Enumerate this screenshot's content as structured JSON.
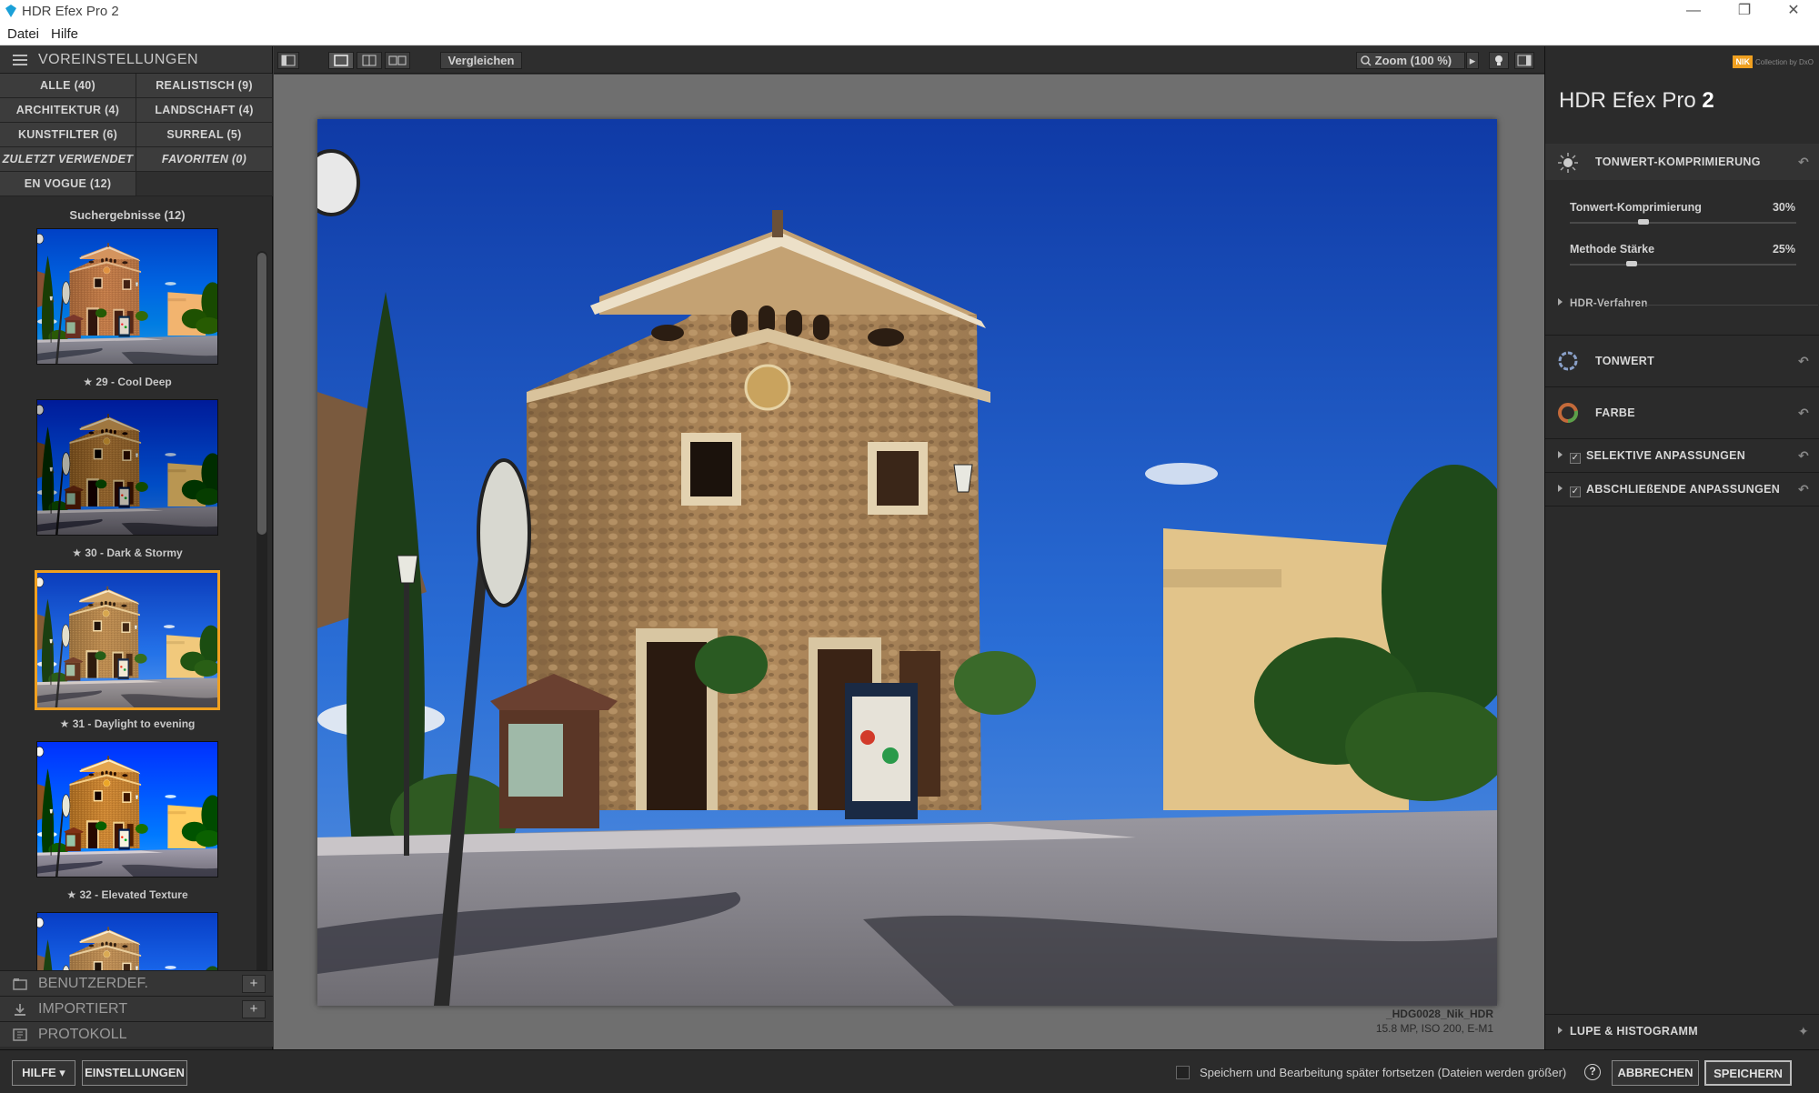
{
  "window": {
    "title": "HDR Efex Pro 2",
    "minimize": "—",
    "restore": "❐",
    "close": "✕"
  },
  "menu": {
    "items": [
      "Datei",
      "Hilfe"
    ]
  },
  "left_panel": {
    "header": "VOREINSTELLUNGEN",
    "presets": [
      "ALLE (40)",
      "REALISTISCH (9)",
      "ARCHITEKTUR (4)",
      "LANDSCHAFT (4)",
      "KUNSTFILTER (6)",
      "SURREAL (5)",
      "ZULETZT VERWENDET",
      "FAVORITEN (0)",
      "EN VOGUE (12)"
    ],
    "results_title": "Suchergebnisse (12)",
    "thumbnails": [
      {
        "label": "★ 29 - Cool Deep",
        "selected": false
      },
      {
        "label": "★ 30 - Dark & Stormy",
        "selected": false
      },
      {
        "label": "★ 31 - Daylight to evening",
        "selected": true
      },
      {
        "label": "★ 32 - Elevated Texture",
        "selected": false
      }
    ],
    "sections": [
      "BENUTZERDEF.",
      "IMPORTIERT",
      "PROTOKOLL"
    ],
    "plus": "+"
  },
  "toolbar": {
    "compare": "Vergleichen",
    "zoom": "Zoom (100 %)",
    "zoom_arrow": "▸"
  },
  "image": {
    "filename": "_HDG0028_Nik_HDR",
    "meta": "15.8 MP, ISO 200, E-M1"
  },
  "right_panel": {
    "logo_badge": "NIK",
    "logo_text": "Collection by DxO",
    "title": "HDR Efex Pro",
    "title_num": "2",
    "section_tonwert_komp": "TONWERT-KOMPRIMIERUNG",
    "sliders": [
      {
        "label": "Tonwert-Komprimierung",
        "value": "30%",
        "level": 0.3
      },
      {
        "label": "Methode Stärke",
        "value": "25%",
        "level": 0.25
      }
    ],
    "hdr_verfahren": "HDR-Verfahren",
    "section_tonwert": "TONWERT",
    "section_farbe": "FARBE",
    "section_selektive": "SELEKTIVE ANPASSUNGEN",
    "section_abschliessende": "ABSCHLIEßENDE ANPASSUNGEN",
    "lupe": "LUPE & HISTOGRAMM",
    "reset_icon": "↶",
    "pin_icon": "✦"
  },
  "bottom_bar": {
    "help": "HILFE ▾",
    "settings": "EINSTELLUNGEN",
    "save_later": "Speichern und Bearbeitung später fortsetzen (Dateien werden größer)",
    "question": "?",
    "cancel": "ABBRECHEN",
    "save": "SPEICHERN"
  },
  "colors": {
    "accent": "#f0a020",
    "sky": "#1f5fc4",
    "stone": "#b08a5a"
  }
}
